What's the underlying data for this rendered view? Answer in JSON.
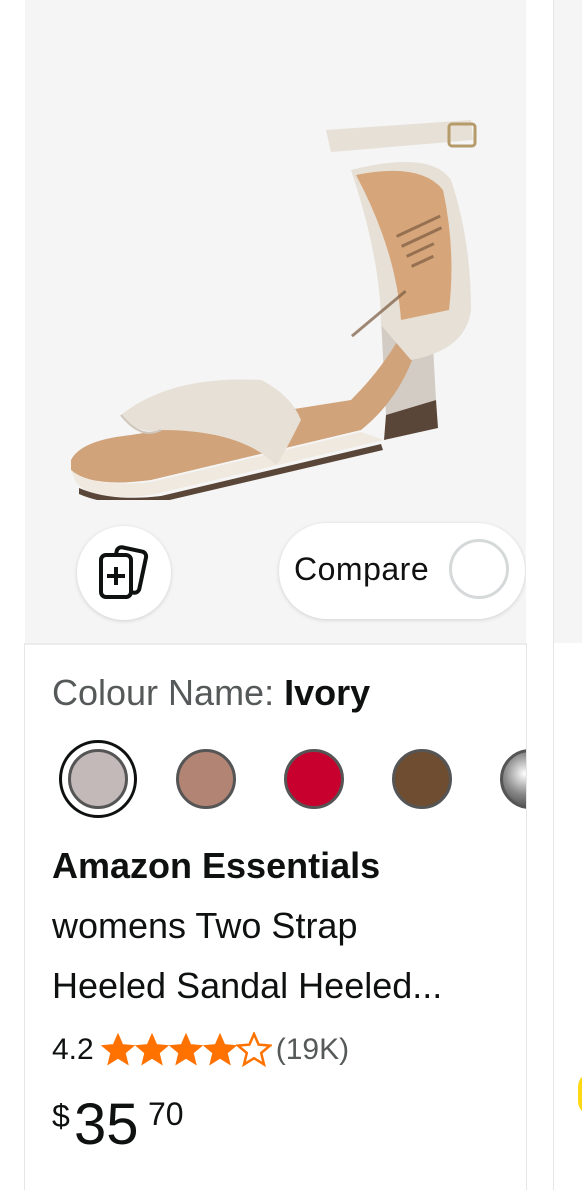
{
  "product_card": {
    "compare": {
      "label": "Compare"
    },
    "colour": {
      "label": "Colour Name:",
      "value": "Ivory"
    },
    "swatches": [
      {
        "name": "ivory",
        "color": "#c4b9b9",
        "selected": true
      },
      {
        "name": "blush",
        "color": "#b28474",
        "selected": false
      },
      {
        "name": "red",
        "color": "#c8002d",
        "selected": false
      },
      {
        "name": "brown",
        "color": "#6e4d30",
        "selected": false
      },
      {
        "name": "metallic",
        "color": "#8a8a8a",
        "selected": false
      }
    ],
    "title": {
      "brand": "Amazon Essentials",
      "line1": "womens Two Strap",
      "line2": "Heeled Sandal Heeled..."
    },
    "rating": {
      "value": "4.2",
      "stars_filled": 4,
      "stars_total": 5,
      "review_count": "(19K)"
    },
    "price": {
      "symbol": "$",
      "whole": "35",
      "fraction": "70"
    },
    "icons": {
      "add_to_list": "add-to-list-icon",
      "star": "star-icon"
    }
  },
  "colors": {
    "accent_star": "#ff7200",
    "text": "#0f1111",
    "muted": "#565959"
  }
}
